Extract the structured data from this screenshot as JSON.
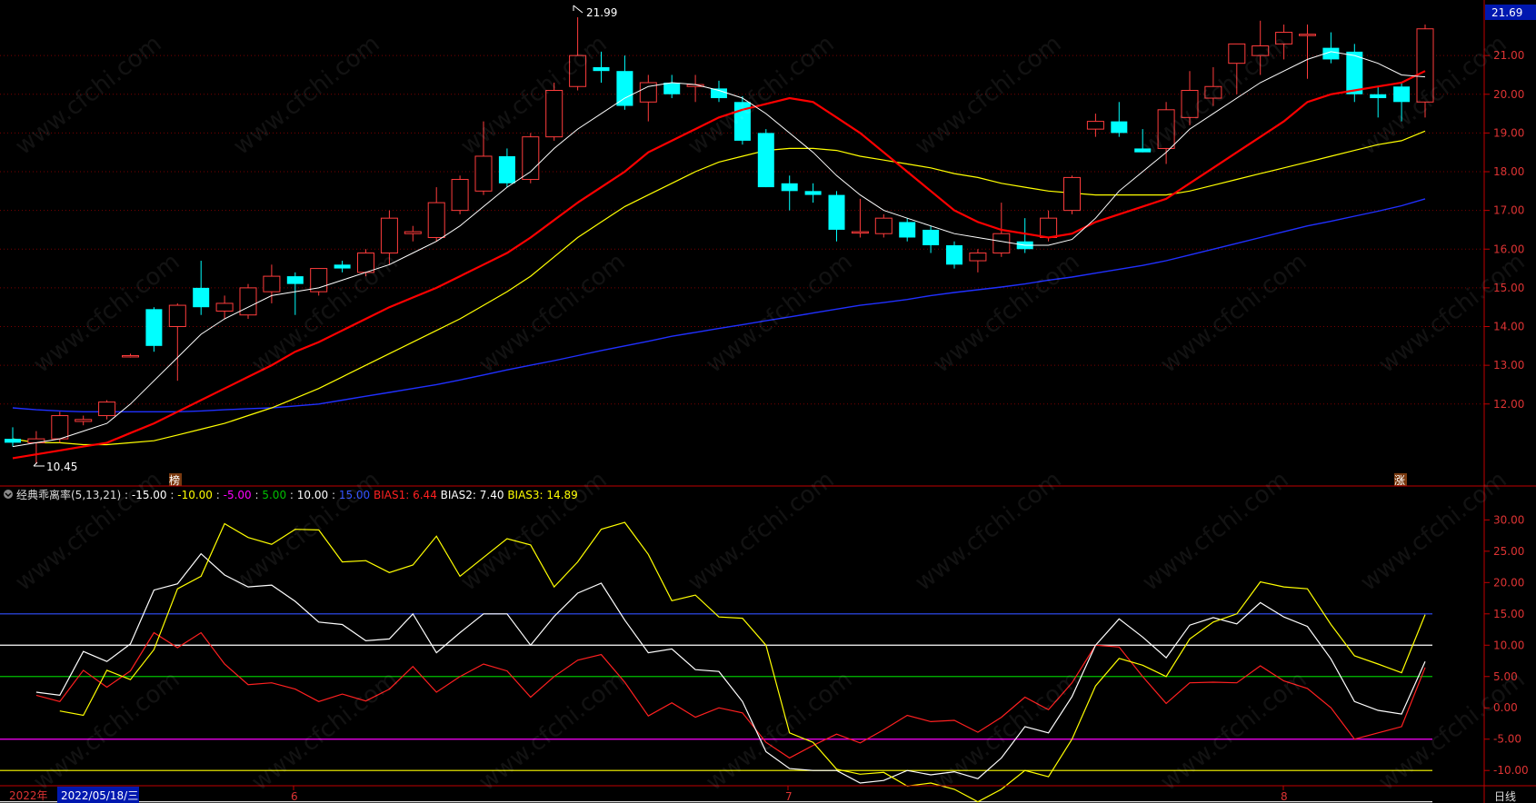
{
  "watermark": "www.cfchi.com",
  "price_panel": {
    "last_price_tag": "21.69",
    "high_label": "21.99",
    "low_label": "10.45",
    "marker_bang": "榜",
    "marker_zhang": "涨",
    "y_ticks": [
      "21.00",
      "20.00",
      "19.00",
      "18.00",
      "17.00",
      "16.00",
      "15.00",
      "14.00",
      "13.00",
      "12.00"
    ]
  },
  "indicator_panel": {
    "name": "经典乖离率(5,13,21)",
    "params": [
      {
        "text": "-15.00",
        "color": "#ffffff"
      },
      {
        "text": "-10.00",
        "color": "#ffff00"
      },
      {
        "text": "-5.00",
        "color": "#ff00ff"
      },
      {
        "text": "5.00",
        "color": "#00c000"
      },
      {
        "text": "10.00",
        "color": "#ffffff"
      },
      {
        "text": "15.00",
        "color": "#3050ff"
      }
    ],
    "bias1_label": "BIAS1:",
    "bias1_value": "6.44",
    "bias2_label": "BIAS2:",
    "bias2_value": "7.40",
    "bias3_label": "BIAS3:",
    "bias3_value": "14.89",
    "y_ticks": [
      "30.00",
      "25.00",
      "20.00",
      "15.00",
      "10.00",
      "5.00",
      "0.00",
      "-5.00",
      "-10.00"
    ]
  },
  "time_axis": {
    "year": "2022年",
    "cursor_date": "2022/05/18/三",
    "month_labels": [
      "6",
      "7",
      "8"
    ],
    "period": "日线"
  },
  "colors": {
    "up": "#ff3c3c",
    "down": "#00ffff",
    "ma5": "#ffffff",
    "ma13": "#ff0000",
    "ma21": "#ffff00",
    "ma60": "#2030ff",
    "axis": "#c00000"
  },
  "chart_data": [
    {
      "type": "candlestick",
      "ylim": [
        10.0,
        22.2
      ],
      "y_ticks": [
        12,
        13,
        14,
        15,
        16,
        17,
        18,
        19,
        20,
        21
      ],
      "candles": [
        {
          "o": 11.1,
          "h": 11.4,
          "l": 10.9,
          "c": 11.0
        },
        {
          "o": 11.0,
          "h": 11.3,
          "l": 10.45,
          "c": 11.1
        },
        {
          "o": 11.1,
          "h": 11.8,
          "l": 11.0,
          "c": 11.7
        },
        {
          "o": 11.55,
          "h": 11.7,
          "l": 11.45,
          "c": 11.6
        },
        {
          "o": 11.7,
          "h": 12.1,
          "l": 11.6,
          "c": 12.05
        },
        {
          "o": 13.25,
          "h": 13.3,
          "l": 13.2,
          "c": 13.25
        },
        {
          "o": 14.45,
          "h": 14.5,
          "l": 13.35,
          "c": 13.5
        },
        {
          "o": 14.0,
          "h": 14.6,
          "l": 12.6,
          "c": 14.55
        },
        {
          "o": 15.0,
          "h": 15.7,
          "l": 14.3,
          "c": 14.5
        },
        {
          "o": 14.4,
          "h": 14.8,
          "l": 14.2,
          "c": 14.6
        },
        {
          "o": 14.3,
          "h": 15.1,
          "l": 14.2,
          "c": 15.0
        },
        {
          "o": 14.9,
          "h": 15.6,
          "l": 14.6,
          "c": 15.3
        },
        {
          "o": 15.3,
          "h": 15.4,
          "l": 14.3,
          "c": 15.1
        },
        {
          "o": 14.9,
          "h": 15.5,
          "l": 14.8,
          "c": 15.5
        },
        {
          "o": 15.6,
          "h": 15.7,
          "l": 15.4,
          "c": 15.5
        },
        {
          "o": 15.4,
          "h": 16.0,
          "l": 15.3,
          "c": 15.9
        },
        {
          "o": 15.9,
          "h": 17.0,
          "l": 15.6,
          "c": 16.8
        },
        {
          "o": 16.4,
          "h": 16.6,
          "l": 16.2,
          "c": 16.45
        },
        {
          "o": 16.3,
          "h": 17.6,
          "l": 16.2,
          "c": 17.2
        },
        {
          "o": 17.0,
          "h": 17.9,
          "l": 16.9,
          "c": 17.8
        },
        {
          "o": 17.5,
          "h": 19.3,
          "l": 17.4,
          "c": 18.4
        },
        {
          "o": 18.4,
          "h": 18.6,
          "l": 17.6,
          "c": 17.7
        },
        {
          "o": 17.8,
          "h": 19.0,
          "l": 17.7,
          "c": 18.9
        },
        {
          "o": 18.9,
          "h": 20.3,
          "l": 18.8,
          "c": 20.1
        },
        {
          "o": 20.2,
          "h": 21.99,
          "l": 20.1,
          "c": 21.0
        },
        {
          "o": 20.7,
          "h": 21.1,
          "l": 20.3,
          "c": 20.6
        },
        {
          "o": 20.6,
          "h": 21.0,
          "l": 19.6,
          "c": 19.7
        },
        {
          "o": 19.8,
          "h": 20.5,
          "l": 19.3,
          "c": 20.3
        },
        {
          "o": 20.3,
          "h": 20.5,
          "l": 19.9,
          "c": 20.0
        },
        {
          "o": 20.2,
          "h": 20.5,
          "l": 19.8,
          "c": 20.25
        },
        {
          "o": 20.15,
          "h": 20.35,
          "l": 19.8,
          "c": 19.9
        },
        {
          "o": 19.8,
          "h": 19.95,
          "l": 18.7,
          "c": 18.8
        },
        {
          "o": 19.0,
          "h": 19.1,
          "l": 17.6,
          "c": 17.6
        },
        {
          "o": 17.7,
          "h": 17.9,
          "l": 17.0,
          "c": 17.5
        },
        {
          "o": 17.5,
          "h": 17.7,
          "l": 17.2,
          "c": 17.4
        },
        {
          "o": 17.4,
          "h": 17.5,
          "l": 16.2,
          "c": 16.5
        },
        {
          "o": 16.45,
          "h": 17.3,
          "l": 16.3,
          "c": 16.45
        },
        {
          "o": 16.4,
          "h": 16.9,
          "l": 16.3,
          "c": 16.8
        },
        {
          "o": 16.7,
          "h": 16.8,
          "l": 16.2,
          "c": 16.3
        },
        {
          "o": 16.5,
          "h": 16.6,
          "l": 15.9,
          "c": 16.1
        },
        {
          "o": 16.1,
          "h": 16.2,
          "l": 15.5,
          "c": 15.6
        },
        {
          "o": 15.7,
          "h": 16.0,
          "l": 15.4,
          "c": 15.9
        },
        {
          "o": 15.9,
          "h": 17.2,
          "l": 15.8,
          "c": 16.4
        },
        {
          "o": 16.2,
          "h": 16.8,
          "l": 15.9,
          "c": 16.0
        },
        {
          "o": 16.3,
          "h": 17.0,
          "l": 16.2,
          "c": 16.8
        },
        {
          "o": 17.0,
          "h": 17.9,
          "l": 16.9,
          "c": 17.85
        },
        {
          "o": 19.1,
          "h": 19.5,
          "l": 18.9,
          "c": 19.3
        },
        {
          "o": 19.3,
          "h": 19.8,
          "l": 18.9,
          "c": 19.0
        },
        {
          "o": 18.6,
          "h": 19.1,
          "l": 18.5,
          "c": 18.5
        },
        {
          "o": 18.6,
          "h": 19.8,
          "l": 18.2,
          "c": 19.6
        },
        {
          "o": 19.4,
          "h": 20.6,
          "l": 19.2,
          "c": 20.1
        },
        {
          "o": 19.9,
          "h": 20.7,
          "l": 19.7,
          "c": 20.2
        },
        {
          "o": 20.8,
          "h": 21.3,
          "l": 20.0,
          "c": 21.3
        },
        {
          "o": 21.0,
          "h": 21.9,
          "l": 20.5,
          "c": 21.25
        },
        {
          "o": 21.3,
          "h": 21.8,
          "l": 20.9,
          "c": 21.6
        },
        {
          "o": 21.55,
          "h": 21.8,
          "l": 20.4,
          "c": 21.55
        },
        {
          "o": 21.2,
          "h": 21.6,
          "l": 20.8,
          "c": 20.9
        },
        {
          "o": 21.1,
          "h": 21.3,
          "l": 19.8,
          "c": 20.0
        },
        {
          "o": 20.0,
          "h": 20.2,
          "l": 19.4,
          "c": 19.9
        },
        {
          "o": 20.2,
          "h": 20.3,
          "l": 19.3,
          "c": 19.8
        },
        {
          "o": 19.8,
          "h": 21.8,
          "l": 19.4,
          "c": 21.69
        }
      ],
      "series": [
        {
          "name": "MA5",
          "color": "#ffffff",
          "values": [
            10.9,
            11.0,
            11.1,
            11.3,
            11.5,
            12.0,
            12.6,
            13.2,
            13.8,
            14.2,
            14.5,
            14.8,
            14.9,
            15.0,
            15.2,
            15.4,
            15.6,
            15.9,
            16.2,
            16.6,
            17.1,
            17.6,
            18.0,
            18.6,
            19.1,
            19.5,
            19.9,
            20.2,
            20.3,
            20.25,
            20.1,
            19.9,
            19.5,
            19.0,
            18.5,
            17.9,
            17.4,
            17.0,
            16.8,
            16.6,
            16.4,
            16.3,
            16.2,
            16.1,
            16.1,
            16.25,
            16.8,
            17.5,
            18.0,
            18.5,
            19.1,
            19.5,
            19.9,
            20.3,
            20.6,
            20.9,
            21.1,
            21.0,
            20.8,
            20.5,
            20.45
          ]
        },
        {
          "name": "MA13",
          "color": "#ff0000",
          "values": [
            10.6,
            10.7,
            10.8,
            10.9,
            11.0,
            11.25,
            11.5,
            11.8,
            12.1,
            12.4,
            12.7,
            13.0,
            13.35,
            13.6,
            13.9,
            14.2,
            14.5,
            14.75,
            15.0,
            15.3,
            15.6,
            15.9,
            16.3,
            16.75,
            17.2,
            17.6,
            18.0,
            18.5,
            18.8,
            19.1,
            19.4,
            19.6,
            19.75,
            19.9,
            19.8,
            19.4,
            19.0,
            18.5,
            18.0,
            17.5,
            17.0,
            16.7,
            16.5,
            16.4,
            16.3,
            16.4,
            16.7,
            16.9,
            17.1,
            17.3,
            17.7,
            18.1,
            18.5,
            18.9,
            19.3,
            19.8,
            20.0,
            20.1,
            20.2,
            20.3,
            20.6
          ]
        },
        {
          "name": "MA21",
          "color": "#ffff00",
          "values": [
            11.1,
            11.0,
            11.0,
            10.95,
            10.95,
            11.0,
            11.05,
            11.2,
            11.35,
            11.5,
            11.7,
            11.9,
            12.15,
            12.4,
            12.7,
            13.0,
            13.3,
            13.6,
            13.9,
            14.2,
            14.55,
            14.9,
            15.3,
            15.8,
            16.3,
            16.7,
            17.1,
            17.4,
            17.7,
            18.0,
            18.25,
            18.4,
            18.55,
            18.6,
            18.6,
            18.55,
            18.4,
            18.3,
            18.2,
            18.1,
            17.95,
            17.85,
            17.7,
            17.6,
            17.5,
            17.45,
            17.4,
            17.4,
            17.4,
            17.4,
            17.5,
            17.65,
            17.8,
            17.95,
            18.1,
            18.25,
            18.4,
            18.55,
            18.7,
            18.8,
            19.05
          ]
        },
        {
          "name": "MA60",
          "color": "#2030ff",
          "values": [
            11.9,
            11.85,
            11.82,
            11.8,
            11.8,
            11.8,
            11.8,
            11.8,
            11.82,
            11.85,
            11.88,
            11.9,
            11.95,
            12.0,
            12.1,
            12.2,
            12.3,
            12.4,
            12.5,
            12.62,
            12.75,
            12.88,
            13.0,
            13.12,
            13.25,
            13.38,
            13.5,
            13.62,
            13.75,
            13.85,
            13.95,
            14.05,
            14.15,
            14.25,
            14.35,
            14.45,
            14.55,
            14.62,
            14.7,
            14.8,
            14.88,
            14.95,
            15.02,
            15.1,
            15.2,
            15.28,
            15.38,
            15.48,
            15.58,
            15.7,
            15.85,
            16.0,
            16.15,
            16.3,
            16.45,
            16.6,
            16.72,
            16.85,
            16.98,
            17.12,
            17.3
          ]
        }
      ]
    },
    {
      "type": "line",
      "title": "经典乖离率(5,13,21)",
      "ylim": [
        -12.0,
        31.5
      ],
      "y_ticks": [
        30,
        25,
        20,
        15,
        10,
        5,
        0,
        -5,
        -10
      ],
      "hlines": [
        {
          "value": 15,
          "color": "#3050ff"
        },
        {
          "value": 10,
          "color": "#ffffff"
        },
        {
          "value": 5,
          "color": "#00c000"
        },
        {
          "value": -5,
          "color": "#ff00ff"
        },
        {
          "value": -10,
          "color": "#ffff00"
        },
        {
          "value": -15,
          "color": "#ffffff"
        }
      ],
      "series": [
        {
          "name": "BIAS1",
          "color": "#ff2020",
          "values": [
            2.0,
            1.0,
            6.0,
            3.3,
            5.9,
            12.0,
            9.6,
            12.0,
            7.0,
            3.7,
            4.0,
            3.0,
            1.0,
            2.2,
            1.1,
            3.0,
            6.6,
            2.5,
            5.0,
            7.0,
            5.9,
            1.7,
            5.0,
            7.6,
            8.5,
            4.1,
            -1.3,
            0.8,
            -1.5,
            0.0,
            -0.8,
            -5.5,
            -8.0,
            -6.0,
            -4.2,
            -5.6,
            -3.5,
            -1.2,
            -2.2,
            -2.0,
            -3.9,
            -1.5,
            1.7,
            -0.3,
            4.0,
            10.0,
            9.7,
            5.0,
            0.7,
            4.0,
            4.1,
            4.0,
            6.7,
            4.3,
            3.1,
            0.0,
            -5.0,
            -4.0,
            -3.0,
            6.44
          ]
        },
        {
          "name": "BIAS2",
          "color": "#ffffff",
          "values": [
            2.5,
            2.0,
            9.0,
            7.4,
            10.2,
            18.8,
            19.8,
            24.6,
            21.2,
            19.3,
            19.6,
            17.0,
            13.7,
            13.3,
            10.7,
            11.0,
            15.0,
            8.8,
            12.0,
            15.0,
            15.0,
            10.0,
            14.6,
            18.3,
            19.9,
            14.0,
            8.8,
            9.4,
            6.1,
            5.8,
            1.0,
            -7.0,
            -9.7,
            -10.0,
            -10.0,
            -12.0,
            -11.6,
            -10.0,
            -10.7,
            -10.2,
            -11.3,
            -8.0,
            -3.0,
            -4.0,
            1.8,
            10.0,
            14.2,
            11.3,
            8.0,
            13.2,
            14.4,
            13.4,
            16.8,
            14.5,
            13.0,
            7.8,
            1.0,
            -0.4,
            -1.0,
            7.4
          ]
        },
        {
          "name": "BIAS3",
          "color": "#ffff00",
          "values": [
            -0.5,
            -1.2,
            6.0,
            4.5,
            9.3,
            19.0,
            21.0,
            29.4,
            27.2,
            26.1,
            28.5,
            28.4,
            23.3,
            23.5,
            21.6,
            22.8,
            27.4,
            21.0,
            24.0,
            27.0,
            26.0,
            19.3,
            23.3,
            28.5,
            29.6,
            24.5,
            17.1,
            18.0,
            14.5,
            14.3,
            10.0,
            -4.0,
            -5.5,
            -9.8,
            -10.6,
            -10.3,
            -12.5,
            -12.0,
            -13.0,
            -15.0,
            -13.0,
            -10.0,
            -11.0,
            -5.0,
            3.5,
            7.9,
            6.8,
            5.0,
            11.0,
            13.7,
            15.0,
            20.1,
            19.3,
            19.0,
            13.3,
            8.3,
            7.0,
            5.6,
            14.89
          ]
        }
      ]
    }
  ]
}
